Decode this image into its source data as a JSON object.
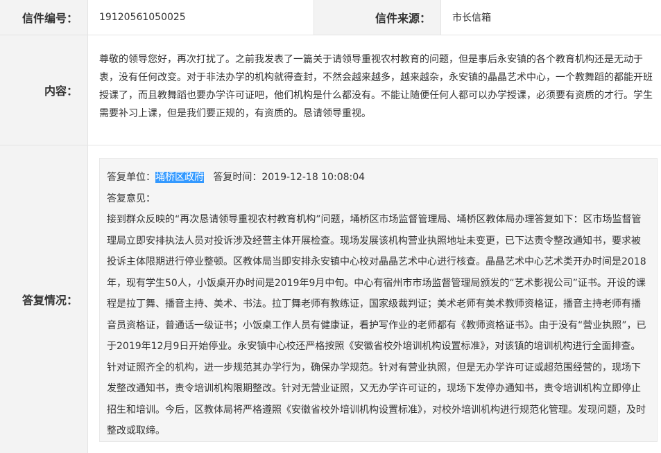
{
  "letter": {
    "number_label": "信件编号：",
    "number_value": "19120561050025",
    "source_label": "信件来源：",
    "source_value": "市长信箱",
    "content_label": "内容：",
    "content_text": "尊敬的领导您好，再次打扰了。之前我发表了一篇关于请领导重视农村教育的问题，但是事后永安镇的各个教育机构还是无动于衷，没有任何改变。对于非法办学的机构就得查封，不然会越来越多，越来越杂，永安镇的晶晶艺术中心，一个教舞蹈的都能开班授课了，而且教舞蹈也要办学许可证吧，他们机构是什么都没有。不能让随便任何人都可以办学授课，必须要有资质的才行。学生需要补习上课，但是我们要正规的，有资质的。恳请领导重视。"
  },
  "reply": {
    "section_label": "答复情况：",
    "unit_label": "答复单位：",
    "unit_value": "埇桥区政府",
    "time_label": "答复时间：",
    "time_value": "2019-12-18 10:08:04",
    "opinion_label": "答复意见：",
    "opinion_text": "接到群众反映的“再次恳请领导重视农村教育机构”问题，埇桥区市场监督管理局、埇桥区教体局办理答复如下：区市场监督管理局立即安排执法人员对投诉涉及经营主体开展检查。现场发展该机构营业执照地址未变更，已下达责令整改通知书，要求被投诉主体限期进行停业整顿。区教体局当即安排永安镇中心校对晶晶艺术中心进行核查。晶晶艺术中心艺术类开办时间是2018年，现有学生50人，小饭桌开办时间是2019年9月中旬。中心有宿州市市场监督管理局颁发的“艺术影视公司”证书。开设的课程是拉丁舞、播音主持、美术、书法。拉丁舞老师有教练证，国家级裁判证；美术老师有美术教师资格证，播音主持老师有播音员资格证，普通话一级证书；小饭桌工作人员有健康证，看护写作业的老师都有《教师资格证书》。由于没有“营业执照”，已于2019年12月9日开始停业。永安镇中心校还严格按照《安徽省校外培训机构设置标准》，对该镇的培训机构进行全面排查。针对证照齐全的机构，进一步规范其办学行为，确保办学规范。针对有营业执照，但是无办学许可证或超范围经营的，现场下发整改通知书，责令培训机构限期整改。针对无营业证照，又无办学许可证的，现场下发停办通知书，责令培训机构立即停止招生和培训。今后，区教体局将严格遵照《安徽省校外培训机构设置标准》，对校外培训机构进行规范化管理。发现问题，及时整改或取缔。"
  }
}
